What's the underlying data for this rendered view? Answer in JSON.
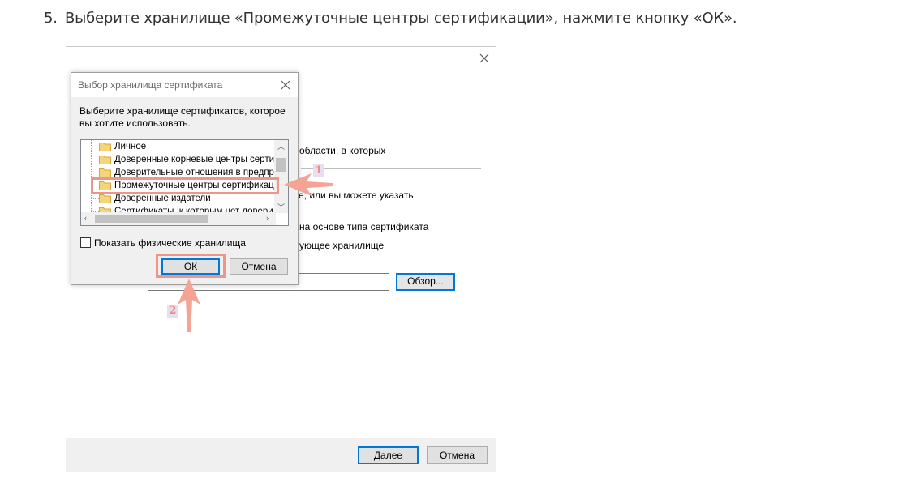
{
  "instruction": {
    "number": "5.",
    "text": "Выберите хранилище «Промежуточные центры сертификации», нажмите кнопку «ОК»."
  },
  "wizard": {
    "partial_text": [
      "области, в которых",
      "е, или вы можете указать",
      "на основе типа сертификата",
      "ующее хранилище"
    ],
    "browse_label": "Обзор...",
    "next_label": "Далее",
    "cancel_label": "Отмена"
  },
  "dialog": {
    "title": "Выбор хранилища сертификата",
    "prompt": "Выберите хранилище сертификатов, которое вы хотите использовать.",
    "stores": [
      "Личное",
      "Доверенные корневые центры сертиф",
      "Доверительные отношения в предпри",
      "Промежуточные центры сертификаци",
      "Доверенные издатели",
      "Сертификаты, к которым нет довери"
    ],
    "selected_store": "Промежуточные центры сертификаци",
    "show_physical_label": "Показать физические хранилища",
    "show_physical_checked": false,
    "ok_label": "ОК",
    "cancel_label": "Отмена"
  },
  "annotations": {
    "badge_1": "1",
    "badge_2": "2",
    "highlight_color": "#f0958a"
  },
  "colors": {
    "accent_blue": "#0078d7",
    "arrow": "#f4a394"
  }
}
